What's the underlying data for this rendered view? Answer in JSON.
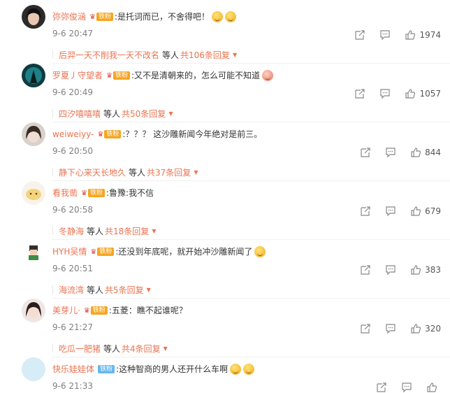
{
  "comments": [
    {
      "name": "弥弥俊涵",
      "badge": "铁粉",
      "text": ":是托词而已，不舍得吧！",
      "emojis": 2,
      "time": "9-6 20:47",
      "likes": "1974",
      "reply_names": "后羿一天不削我一天不改名",
      "reply_mid": "等人",
      "reply_total": "共106条回复"
    },
    {
      "name": "罗夏丿守望者",
      "badge": "铁粉",
      "text": ":又不是清朝来的，怎么可能不知道",
      "emojis": 1,
      "time": "9-6 20:49",
      "likes": "1057",
      "reply_names": "四汐嘻嘻嘻",
      "reply_mid": "等人",
      "reply_total": "共50条回复"
    },
    {
      "name": "weiweiyy-",
      "badge": "铁粉",
      "text": ":？？？ 这沙雕新闻今年绝对是前三。",
      "emojis": 0,
      "time": "9-6 20:50",
      "likes": "844",
      "reply_names": "静下心来天长地久",
      "reply_mid": "等人",
      "reply_total": "共37条回复"
    },
    {
      "name": "看我凿",
      "badge": "铁粉",
      "text": ":鲁豫:我不信",
      "emojis": 0,
      "time": "9-6 20:58",
      "likes": "679",
      "reply_names": "冬静海",
      "reply_mid": "等人",
      "reply_total": "共18条回复"
    },
    {
      "name": "HYH吴情",
      "badge": "铁粉",
      "text": ":还没到年底呢，就开始冲沙雕新闻了",
      "emojis": 1,
      "time": "9-6 20:51",
      "likes": "383",
      "reply_names": "海流湾",
      "reply_mid": "等人",
      "reply_total": "共5条回复"
    },
    {
      "name": "美芽儿·",
      "badge": "铁粉",
      "text": ":五菱：瞧不起谁呢？",
      "emojis": 0,
      "time": "9-6 21:27",
      "likes": "320",
      "reply_names": "吃瓜一肥猪",
      "reply_mid": "等人",
      "reply_total": "共4条回复"
    },
    {
      "name": "快乐娃娃体",
      "badge": "铁粉",
      "text": ":这种智商的男人还开什么车啊",
      "emojis": 2,
      "time": "9-6 21:33",
      "likes": "",
      "reply_names": "",
      "reply_mid": "",
      "reply_total": ""
    }
  ],
  "icons": {
    "forward": "forward-icon",
    "comment": "comment-icon",
    "like": "like-icon",
    "crown": "crown-icon",
    "reply_arrow": "caret-down-icon"
  },
  "colors": {
    "accent": "#eb7350",
    "badge": "#f5a623",
    "badge_blue": "#66b7f0",
    "text": "#333333",
    "muted": "#808080"
  }
}
